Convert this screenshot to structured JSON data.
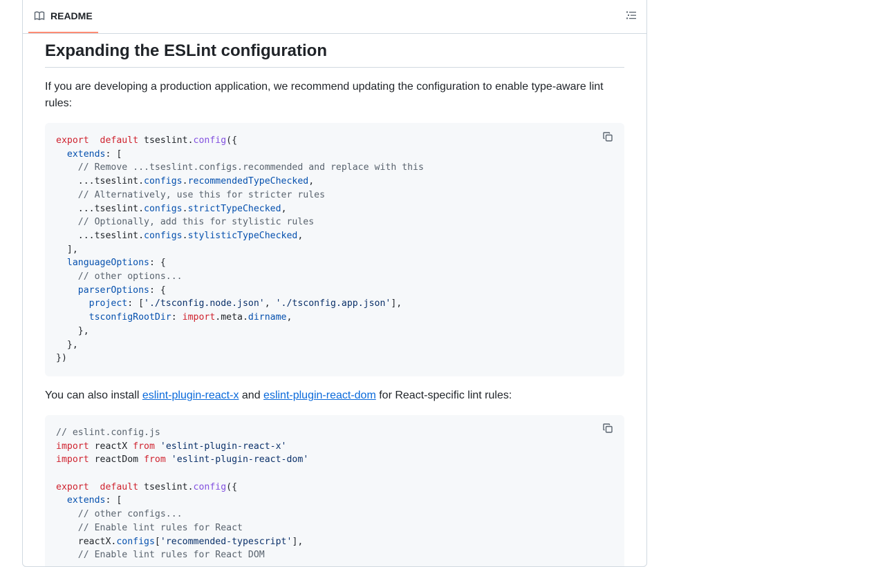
{
  "header": {
    "tab_label": "README"
  },
  "section": {
    "heading": "Expanding the ESLint configuration",
    "intro": "If you are developing a production application, we recommend updating the configuration to enable type-aware lint rules:",
    "install_prefix": "You can also install ",
    "link1": "eslint-plugin-react-x",
    "install_and": " and ",
    "link2": "eslint-plugin-react-dom",
    "install_suffix": " for React-specific lint rules:"
  },
  "code1": [
    [
      [
        "k",
        "export"
      ],
      [
        "",
        "  "
      ],
      [
        "k",
        "default"
      ],
      [
        "",
        " tseslint."
      ],
      [
        "f",
        "config"
      ],
      [
        "",
        "({"
      ]
    ],
    [
      [
        "",
        "  "
      ],
      [
        "p",
        "extends"
      ],
      [
        "",
        ": ["
      ]
    ],
    [
      [
        "",
        "    "
      ],
      [
        "c",
        "// Remove ...tseslint.configs.recommended and replace with this"
      ]
    ],
    [
      [
        "",
        "    ...tseslint."
      ],
      [
        "p",
        "configs"
      ],
      [
        "",
        "."
      ],
      [
        "p",
        "recommendedTypeChecked"
      ],
      [
        "",
        ","
      ]
    ],
    [
      [
        "",
        "    "
      ],
      [
        "c",
        "// Alternatively, use this for stricter rules"
      ]
    ],
    [
      [
        "",
        "    ...tseslint."
      ],
      [
        "p",
        "configs"
      ],
      [
        "",
        "."
      ],
      [
        "p",
        "strictTypeChecked"
      ],
      [
        "",
        ","
      ]
    ],
    [
      [
        "",
        "    "
      ],
      [
        "c",
        "// Optionally, add this for stylistic rules"
      ]
    ],
    [
      [
        "",
        "    ...tseslint."
      ],
      [
        "p",
        "configs"
      ],
      [
        "",
        "."
      ],
      [
        "p",
        "stylisticTypeChecked"
      ],
      [
        "",
        ","
      ]
    ],
    [
      [
        "",
        "  ],"
      ]
    ],
    [
      [
        "",
        "  "
      ],
      [
        "p",
        "languageOptions"
      ],
      [
        "",
        ": {"
      ]
    ],
    [
      [
        "",
        "    "
      ],
      [
        "c",
        "// other options..."
      ]
    ],
    [
      [
        "",
        "    "
      ],
      [
        "p",
        "parserOptions"
      ],
      [
        "",
        ": {"
      ]
    ],
    [
      [
        "",
        "      "
      ],
      [
        "p",
        "project"
      ],
      [
        "",
        ": ["
      ],
      [
        "s",
        "'./tsconfig.node.json'"
      ],
      [
        "",
        ", "
      ],
      [
        "s",
        "'./tsconfig.app.json'"
      ],
      [
        "",
        "],"
      ]
    ],
    [
      [
        "",
        "      "
      ],
      [
        "p",
        "tsconfigRootDir"
      ],
      [
        "",
        ": "
      ],
      [
        "k",
        "import"
      ],
      [
        "",
        ".meta."
      ],
      [
        "p",
        "dirname"
      ],
      [
        "",
        ","
      ]
    ],
    [
      [
        "",
        "    },"
      ]
    ],
    [
      [
        "",
        "  },"
      ]
    ],
    [
      [
        "",
        "})"
      ]
    ]
  ],
  "code2": [
    [
      [
        "c",
        "// eslint.config.js"
      ]
    ],
    [
      [
        "k",
        "import"
      ],
      [
        "",
        " reactX "
      ],
      [
        "k",
        "from"
      ],
      [
        "",
        " "
      ],
      [
        "s",
        "'eslint-plugin-react-x'"
      ]
    ],
    [
      [
        "k",
        "import"
      ],
      [
        "",
        " reactDom "
      ],
      [
        "k",
        "from"
      ],
      [
        "",
        " "
      ],
      [
        "s",
        "'eslint-plugin-react-dom'"
      ]
    ],
    [
      [
        "",
        ""
      ]
    ],
    [
      [
        "k",
        "export"
      ],
      [
        "",
        "  "
      ],
      [
        "k",
        "default"
      ],
      [
        "",
        " tseslint."
      ],
      [
        "f",
        "config"
      ],
      [
        "",
        "({"
      ]
    ],
    [
      [
        "",
        "  "
      ],
      [
        "p",
        "extends"
      ],
      [
        "",
        ": ["
      ]
    ],
    [
      [
        "",
        "    "
      ],
      [
        "c",
        "// other configs..."
      ]
    ],
    [
      [
        "",
        "    "
      ],
      [
        "c",
        "// Enable lint rules for React"
      ]
    ],
    [
      [
        "",
        "    reactX."
      ],
      [
        "p",
        "configs"
      ],
      [
        "",
        "["
      ],
      [
        "s",
        "'recommended-typescript'"
      ],
      [
        "",
        "],"
      ]
    ],
    [
      [
        "",
        "    "
      ],
      [
        "c",
        "// Enable lint rules for React DOM"
      ]
    ]
  ]
}
